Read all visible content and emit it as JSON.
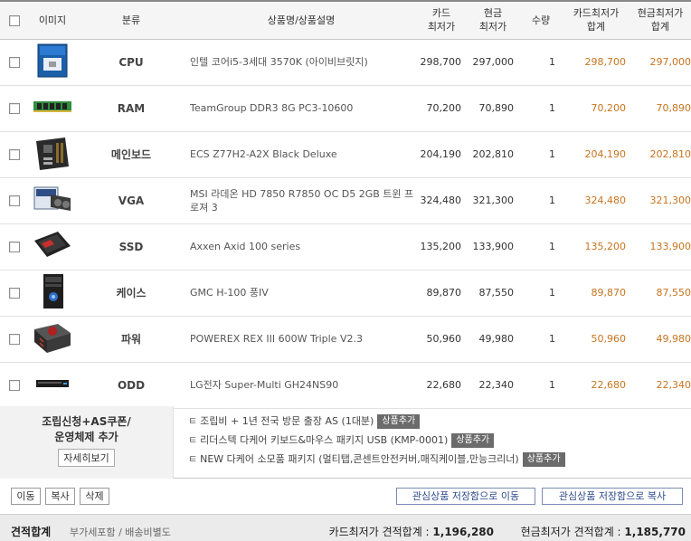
{
  "header": {
    "image": "이미지",
    "category": "분류",
    "product": "상품명/상품설명",
    "card_price": [
      "카드",
      "최저가"
    ],
    "cash_price": [
      "현금",
      "최저가"
    ],
    "quantity": "수량",
    "card_sum": [
      "카드최저가",
      "합계"
    ],
    "cash_sum": [
      "현금최저가",
      "합계"
    ]
  },
  "items": [
    {
      "category": "CPU",
      "name": "인텔 코어i5-3세대 3570K (아이비브릿지)",
      "card": "298,700",
      "cash": "297,000",
      "qty": "1",
      "card_sum": "298,700",
      "cash_sum": "297,000",
      "icon": "cpu-box-icon"
    },
    {
      "category": "RAM",
      "name": "TeamGroup DDR3 8G PC3-10600",
      "card": "70,200",
      "cash": "70,890",
      "qty": "1",
      "card_sum": "70,200",
      "cash_sum": "70,890",
      "icon": "ram-stick-icon"
    },
    {
      "category": "메인보드",
      "name": "ECS Z77H2-A2X Black Deluxe",
      "card": "204,190",
      "cash": "202,810",
      "qty": "1",
      "card_sum": "204,190",
      "cash_sum": "202,810",
      "icon": "motherboard-icon"
    },
    {
      "category": "VGA",
      "name": "MSI 라데온 HD 7850 R7850 OC D5 2GB 트윈 프로져 3",
      "card": "324,480",
      "cash": "321,300",
      "qty": "1",
      "card_sum": "324,480",
      "cash_sum": "321,300",
      "icon": "graphics-card-icon"
    },
    {
      "category": "SSD",
      "name": "Axxen Axid 100 series",
      "card": "135,200",
      "cash": "133,900",
      "qty": "1",
      "card_sum": "135,200",
      "cash_sum": "133,900",
      "icon": "ssd-icon"
    },
    {
      "category": "케이스",
      "name": "GMC H-100 풍IV",
      "card": "89,870",
      "cash": "87,550",
      "qty": "1",
      "card_sum": "89,870",
      "cash_sum": "87,550",
      "icon": "pc-case-icon"
    },
    {
      "category": "파워",
      "name": "POWEREX REX III 600W Triple V2.3",
      "card": "50,960",
      "cash": "49,980",
      "qty": "1",
      "card_sum": "50,960",
      "cash_sum": "49,980",
      "icon": "power-supply-icon"
    },
    {
      "category": "ODD",
      "name": "LG전자 Super-Multi GH24NS90",
      "card": "22,680",
      "cash": "22,340",
      "qty": "1",
      "card_sum": "22,680",
      "cash_sum": "22,340",
      "icon": "optical-drive-icon"
    }
  ],
  "addon": {
    "title_line1": "조립신청+AS쿠폰/",
    "title_line2": "운영체제 추가",
    "detail_button": "자세히보기",
    "arrow": "ㅌ",
    "options": [
      {
        "label": "조립비 + 1년 전국 방문 출장 AS (1대분)",
        "button": "상품추가"
      },
      {
        "label": "리더스텍 다케어 키보드&마우스 패키지 USB (KMP-0001)",
        "button": "상품추가"
      },
      {
        "label": "NEW 다케어 소모품 패키지 (멀티탭,콘센트안전커버,매직케이블,만능크리너)",
        "button": "상품추가"
      }
    ]
  },
  "actions": {
    "move": "이동",
    "copy": "복사",
    "delete": "삭제",
    "save_move": "관심상품 저장함으로 이동",
    "save_copy": "관심상품 저장함으로 복사"
  },
  "total": {
    "title": "견적합계",
    "note": "부가세포함 / 배송비별도",
    "card_label": "카드최저가 견적합계 : ",
    "card_value": "1,196,280",
    "cash_label": "현금최저가 견적합계 : ",
    "cash_value": "1,185,770"
  },
  "colors": {
    "sum_text": "#c8741e",
    "header_bg": "#f5f5f5",
    "addon_button_bg": "#6b6b6b",
    "total_bg": "#ebebeb"
  }
}
